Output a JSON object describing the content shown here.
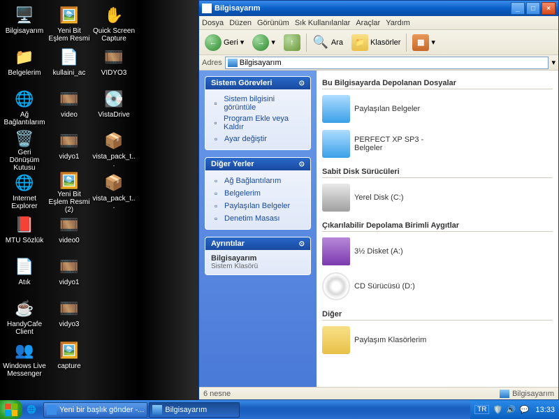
{
  "desktop": {
    "icons": [
      {
        "label": "Bilgisayarım",
        "glyph": "🖥️"
      },
      {
        "label": "Yeni Bit Eşlem Resmi",
        "glyph": "🖼️"
      },
      {
        "label": "Quick Screen Capture",
        "glyph": "✋"
      },
      {
        "label": "Belgelerim",
        "glyph": "📁"
      },
      {
        "label": "kullaini_ac",
        "glyph": "📄"
      },
      {
        "label": "VIDYO3",
        "glyph": "🎞️"
      },
      {
        "label": "Ağ Bağlantılarım",
        "glyph": "🌐"
      },
      {
        "label": "video",
        "glyph": "🎞️"
      },
      {
        "label": "VistaDrive",
        "glyph": "💽"
      },
      {
        "label": "Geri Dönüşüm Kutusu",
        "glyph": "🗑️"
      },
      {
        "label": "vidyo1",
        "glyph": "🎞️"
      },
      {
        "label": "vista_pack_t...",
        "glyph": "📦"
      },
      {
        "label": "Internet Explorer",
        "glyph": "🌐"
      },
      {
        "label": "Yeni Bit Eşlem Resmi (2)",
        "glyph": "🖼️"
      },
      {
        "label": "vista_pack_t...",
        "glyph": "📦"
      },
      {
        "label": "MTU Sözlük",
        "glyph": "📕"
      },
      {
        "label": "video0",
        "glyph": "🎞️"
      },
      {
        "label": "",
        "glyph": ""
      },
      {
        "label": "Atık",
        "glyph": "📄"
      },
      {
        "label": "vidyo1",
        "glyph": "🎞️"
      },
      {
        "label": "",
        "glyph": ""
      },
      {
        "label": "HandyCafe Client",
        "glyph": "☕"
      },
      {
        "label": "vidyo3",
        "glyph": "🎞️"
      },
      {
        "label": "",
        "glyph": ""
      },
      {
        "label": "Windows Live Messenger",
        "glyph": "👥"
      },
      {
        "label": "capture",
        "glyph": "🖼️"
      }
    ]
  },
  "window": {
    "title": "Bilgisayarım",
    "menu": [
      "Dosya",
      "Düzen",
      "Görünüm",
      "Sık Kullanılanlar",
      "Araçlar",
      "Yardım"
    ],
    "toolbar": {
      "back": "Geri",
      "search": "Ara",
      "folders": "Klasörler"
    },
    "address": {
      "label": "Adres",
      "value": "Bilgisayarım"
    },
    "sidebar": {
      "tasks": {
        "title": "Sistem Görevleri",
        "items": [
          "Sistem bilgisini görüntüle",
          "Program Ekle veya Kaldır",
          "Ayar değiştir"
        ]
      },
      "places": {
        "title": "Diğer Yerler",
        "items": [
          "Ağ Bağlantılarım",
          "Belgelerim",
          "Paylaşılan Belgeler",
          "Denetim Masası"
        ]
      },
      "details": {
        "title": "Ayrıntılar",
        "name": "Bilgisayarım",
        "type": "Sistem Klasörü"
      }
    },
    "content": {
      "sec1": {
        "title": "Bu Bilgisayarda Depolanan Dosyalar",
        "items": [
          "Paylaşılan Belgeler",
          "PERFECT XP SP3 - Belgeler"
        ]
      },
      "sec2": {
        "title": "Sabit Disk Sürücüleri",
        "items": [
          "Yerel Disk (C:)"
        ]
      },
      "sec3": {
        "title": "Çıkarılabilir Depolama Birimli Aygıtlar",
        "items": [
          "3½ Disket (A:)",
          "CD Sürücüsü (D:)"
        ]
      },
      "sec4": {
        "title": "Diğer",
        "items": [
          "Paylaşım Klasörlerim"
        ]
      }
    },
    "status": {
      "left": "6 nesne",
      "right": "Bilgisayarım"
    }
  },
  "taskbar": {
    "tasks": [
      {
        "label": "Yeni bir başlık gönder -...",
        "active": false
      },
      {
        "label": "Bilgisayarım",
        "active": true
      }
    ],
    "lang": "TR",
    "clock": "13:33"
  }
}
